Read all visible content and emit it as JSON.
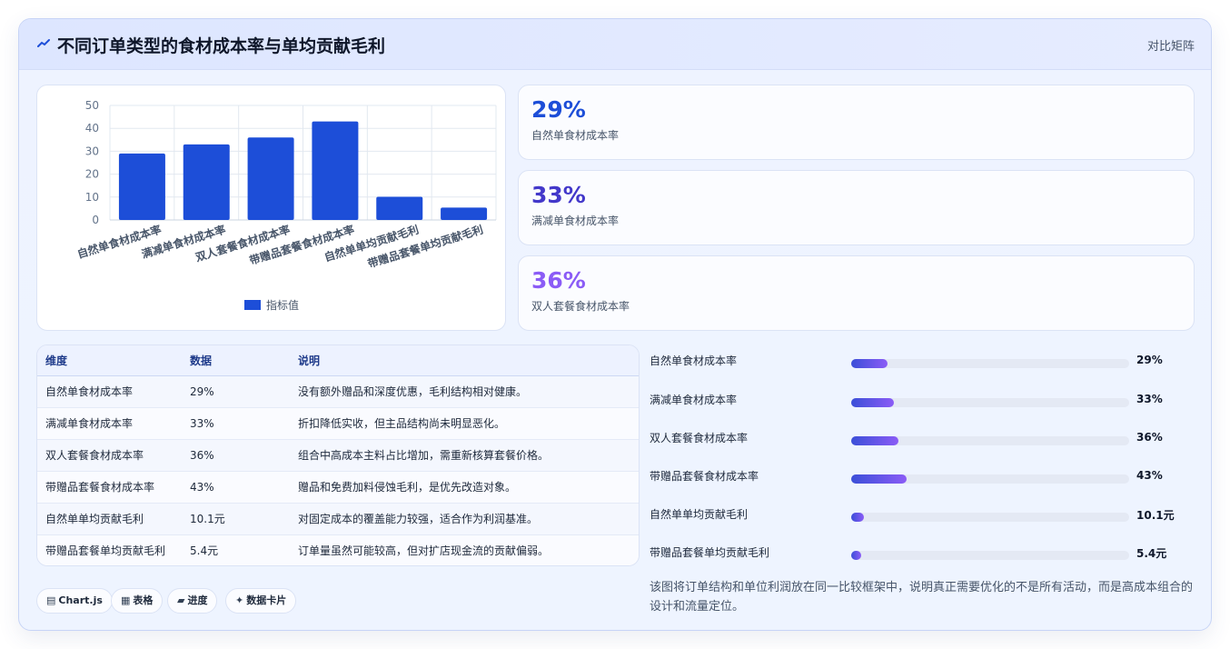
{
  "header": {
    "title": "不同订单类型的食材成本率与单均贡献毛利",
    "badge": "对比矩阵"
  },
  "chart_data": {
    "type": "bar",
    "categories": [
      "自然单食材成本率",
      "满减单食材成本率",
      "双人套餐食材成本率",
      "带赠品套餐食材成本率",
      "自然单单均贡献毛利",
      "带赠品套餐单均贡献毛利"
    ],
    "series": [
      {
        "name": "指标值",
        "values": [
          29,
          33,
          36,
          43,
          10.1,
          5.4
        ]
      }
    ],
    "ylim": [
      0,
      50
    ],
    "yticks": [
      0,
      10,
      20,
      30,
      40,
      50
    ],
    "grid": true,
    "legend": "bottom",
    "color": "#1d4ed8"
  },
  "kpis": [
    {
      "value": "29%",
      "label": "自然单食材成本率",
      "color": "#1d4ed8"
    },
    {
      "value": "33%",
      "label": "满减单食材成本率",
      "color": "#4338ca"
    },
    {
      "value": "36%",
      "label": "双人套餐食材成本率",
      "color": "#8b5cf6"
    }
  ],
  "table": {
    "headers": [
      "维度",
      "数据",
      "说明"
    ],
    "rows": [
      [
        "自然单食材成本率",
        "29%",
        "没有额外赠品和深度优惠，毛利结构相对健康。"
      ],
      [
        "满减单食材成本率",
        "33%",
        "折扣降低实收，但主品结构尚未明显恶化。"
      ],
      [
        "双人套餐食材成本率",
        "36%",
        "组合中高成本主料占比增加，需重新核算套餐价格。"
      ],
      [
        "带赠品套餐食材成本率",
        "43%",
        "赠品和免费加料侵蚀毛利，是优先改造对象。"
      ],
      [
        "自然单单均贡献毛利",
        "10.1元",
        "对固定成本的覆盖能力较强，适合作为利润基准。"
      ],
      [
        "带赠品套餐单均贡献毛利",
        "5.4元",
        "订单量虽然可能较高，但对扩店现金流的贡献偏弱。"
      ]
    ]
  },
  "progress": [
    {
      "label": "自然单食材成本率",
      "value_text": "29%",
      "fraction": 0.13
    },
    {
      "label": "满减单食材成本率",
      "value_text": "33%",
      "fraction": 0.155
    },
    {
      "label": "双人套餐食材成本率",
      "value_text": "36%",
      "fraction": 0.17
    },
    {
      "label": "带赠品套餐食材成本率",
      "value_text": "43%",
      "fraction": 0.2
    },
    {
      "label": "自然单单均贡献毛利",
      "value_text": "10.1元",
      "fraction": 0.045
    },
    {
      "label": "带赠品套餐单均贡献毛利",
      "value_text": "5.4元",
      "fraction": 0.035
    }
  ],
  "pills": [
    {
      "icon": "chart-icon",
      "glyph": "▤",
      "label": "Chart.js"
    },
    {
      "icon": "table-icon",
      "glyph": "▦",
      "label": "表格"
    },
    {
      "icon": "progress-icon",
      "glyph": "▰",
      "label": "进度"
    },
    {
      "icon": "card-icon",
      "glyph": "✦",
      "label": "数据卡片"
    }
  ],
  "note": "该图将订单结构和单位利润放在同一比较框架中，说明真正需要优化的不是所有活动，而是高成本组合的设计和流量定位。"
}
